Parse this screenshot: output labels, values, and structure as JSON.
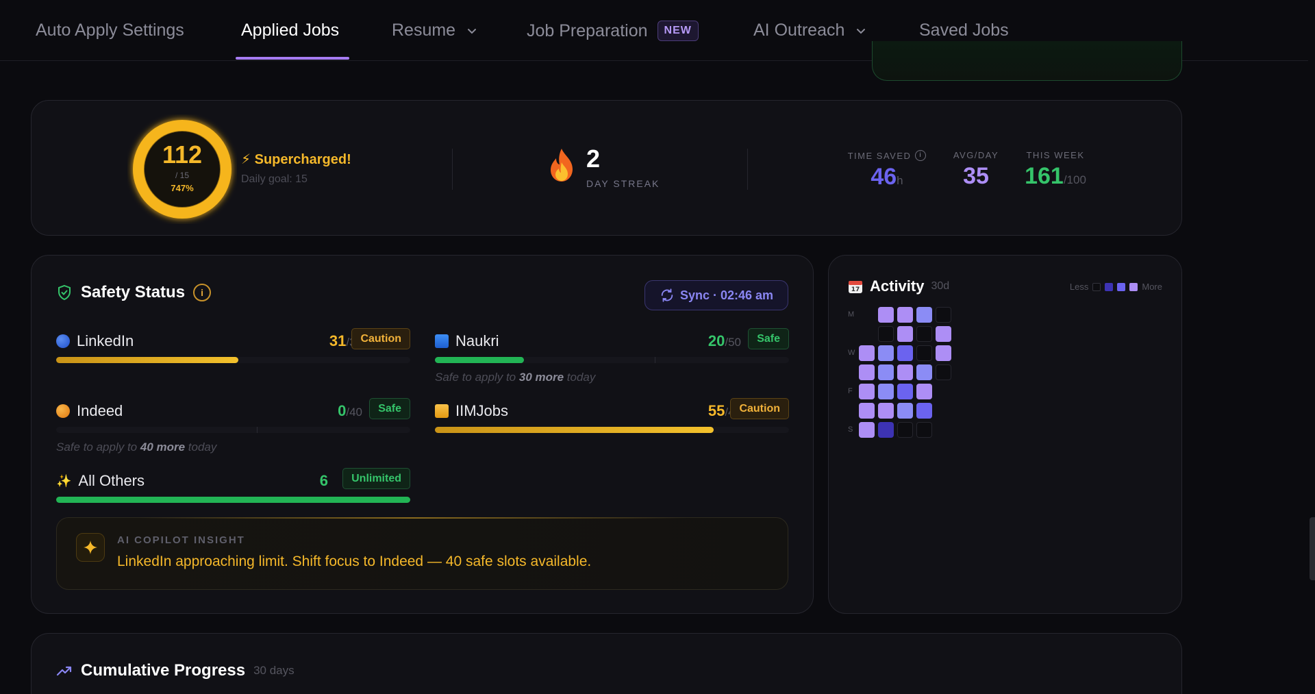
{
  "nav": {
    "items": [
      {
        "label": "Auto Apply Settings"
      },
      {
        "label": "Applied Jobs"
      },
      {
        "label": "Resume"
      },
      {
        "label": "Job Preparation",
        "badge": "NEW"
      },
      {
        "label": "AI Outreach"
      },
      {
        "label": "Saved Jobs"
      }
    ],
    "active": "Applied Jobs"
  },
  "stats": {
    "applied_today": "112",
    "goal_fraction": "/ 15",
    "percent": "747%",
    "status": "⚡ Supercharged!",
    "daily_goal": "Daily goal: 15",
    "streak_value": "2",
    "streak_label": "DAY STREAK",
    "time_saved_label": "TIME SAVED",
    "time_saved_value": "46",
    "time_saved_unit": "h",
    "avg_day_label": "AVG/DAY",
    "avg_day_value": "35",
    "this_week_label": "THIS WEEK",
    "this_week_value": "161",
    "this_week_target": "/100"
  },
  "safety": {
    "title": "Safety Status",
    "info": "i",
    "sync_label": "Sync · 02:46 am",
    "platforms": [
      {
        "name": "LinkedIn",
        "count": "31",
        "limit": "/30",
        "status": "Caution",
        "fill": 1.0,
        "hint_pre": "",
        "hint_bold": "",
        "hint_post": ""
      },
      {
        "name": "Naukri",
        "count": "20",
        "limit": "/50",
        "status": "Safe",
        "fill": 0.4,
        "hint_pre": "Safe to apply to ",
        "hint_bold": "30 more",
        "hint_post": " today"
      },
      {
        "name": "Indeed",
        "count": "0",
        "limit": "/40",
        "status": "Safe",
        "fill": 0.0,
        "hint_pre": "Safe to apply to ",
        "hint_bold": "40 more",
        "hint_post": " today"
      },
      {
        "name": "IIMJobs",
        "count": "55",
        "limit": "/40",
        "status": "Caution",
        "fill": 1.0,
        "hint_pre": "",
        "hint_bold": "",
        "hint_post": ""
      },
      {
        "name": "All Others",
        "count": "6",
        "limit": "",
        "status": "Unlimited",
        "fill": 1.0
      }
    ],
    "insight_label": "AI COPILOT INSIGHT",
    "insight_text": "LinkedIn approaching limit. Shift focus to Indeed — 40 safe slots available."
  },
  "activity": {
    "title": "Activity",
    "range": "30d",
    "legend_less": "Less",
    "legend_more": "More",
    "day_labels": [
      "M",
      "W",
      "F",
      "S"
    ],
    "grid": [
      [
        -1,
        4,
        4,
        3,
        0
      ],
      [
        -1,
        0,
        4,
        0,
        4
      ],
      [
        4,
        3,
        2,
        0,
        4
      ],
      [
        4,
        3,
        4,
        3,
        0
      ],
      [
        4,
        3,
        2,
        4,
        -1
      ],
      [
        4,
        4,
        3,
        2,
        -1
      ],
      [
        4,
        1,
        0,
        0,
        -1
      ]
    ]
  },
  "cumulative": {
    "title": "Cumulative Progress",
    "range": "30 days"
  },
  "colors": {
    "accent_purple": "#a67cf2",
    "caution": "#f5b82a",
    "safe": "#35c46a",
    "time_saved": "#6b63ef",
    "avg": "#ad8ef5",
    "week": "#35c46a"
  }
}
